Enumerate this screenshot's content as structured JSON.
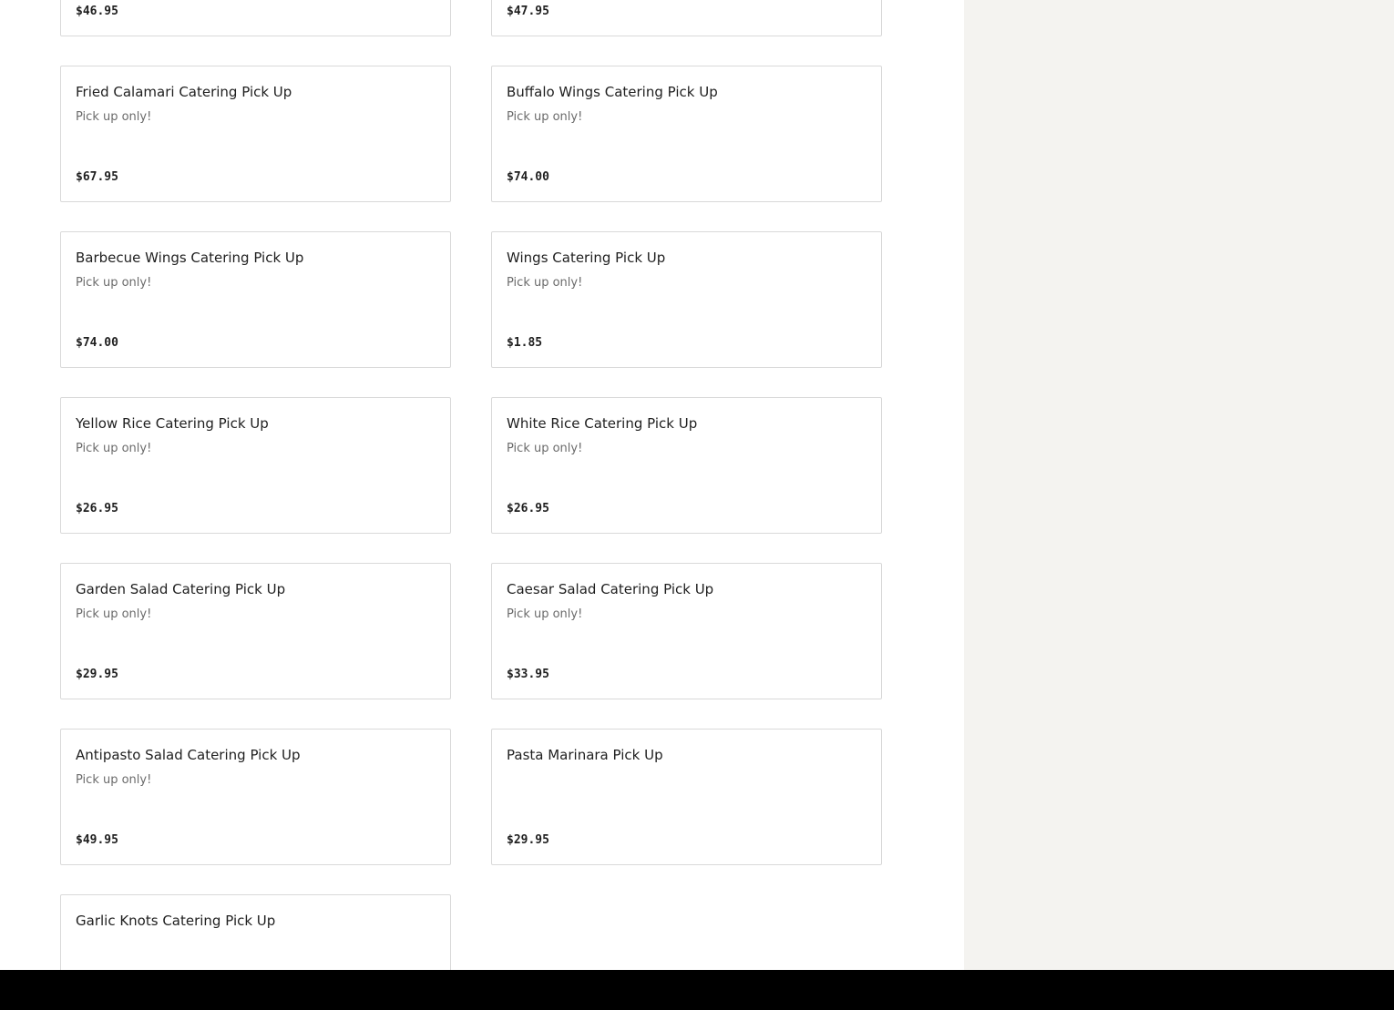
{
  "menu": {
    "items": [
      {
        "title": "",
        "description": "",
        "price": "$46.95"
      },
      {
        "title": "",
        "description": "",
        "price": "$47.95"
      },
      {
        "title": "Fried Calamari Catering Pick Up",
        "description": "Pick up only!",
        "price": "$67.95"
      },
      {
        "title": "Buffalo Wings Catering Pick Up",
        "description": "Pick up only!",
        "price": "$74.00"
      },
      {
        "title": "Barbecue Wings Catering Pick Up",
        "description": "Pick up only!",
        "price": "$74.00"
      },
      {
        "title": "Wings Catering Pick Up",
        "description": "Pick up only!",
        "price": "$1.85"
      },
      {
        "title": "Yellow Rice Catering Pick Up",
        "description": "Pick up only!",
        "price": "$26.95"
      },
      {
        "title": "White Rice Catering Pick Up",
        "description": "Pick up only!",
        "price": "$26.95"
      },
      {
        "title": "Garden Salad Catering Pick Up",
        "description": "Pick up only!",
        "price": "$29.95"
      },
      {
        "title": "Caesar Salad Catering Pick Up",
        "description": "Pick up only!",
        "price": "$33.95"
      },
      {
        "title": "Antipasto Salad Catering Pick Up",
        "description": "Pick up only!",
        "price": "$49.95"
      },
      {
        "title": "Pasta Marinara Pick Up",
        "description": "",
        "price": "$29.95"
      },
      {
        "title": "Garlic Knots Catering Pick Up",
        "description": "",
        "price": ""
      }
    ]
  },
  "colors": {
    "card_border": "#d9d9d9",
    "side_panel": "#f4f3f0",
    "bottom_bar": "#000000",
    "title_text": "#1f1f1f",
    "description_text": "#6b6b6b"
  }
}
